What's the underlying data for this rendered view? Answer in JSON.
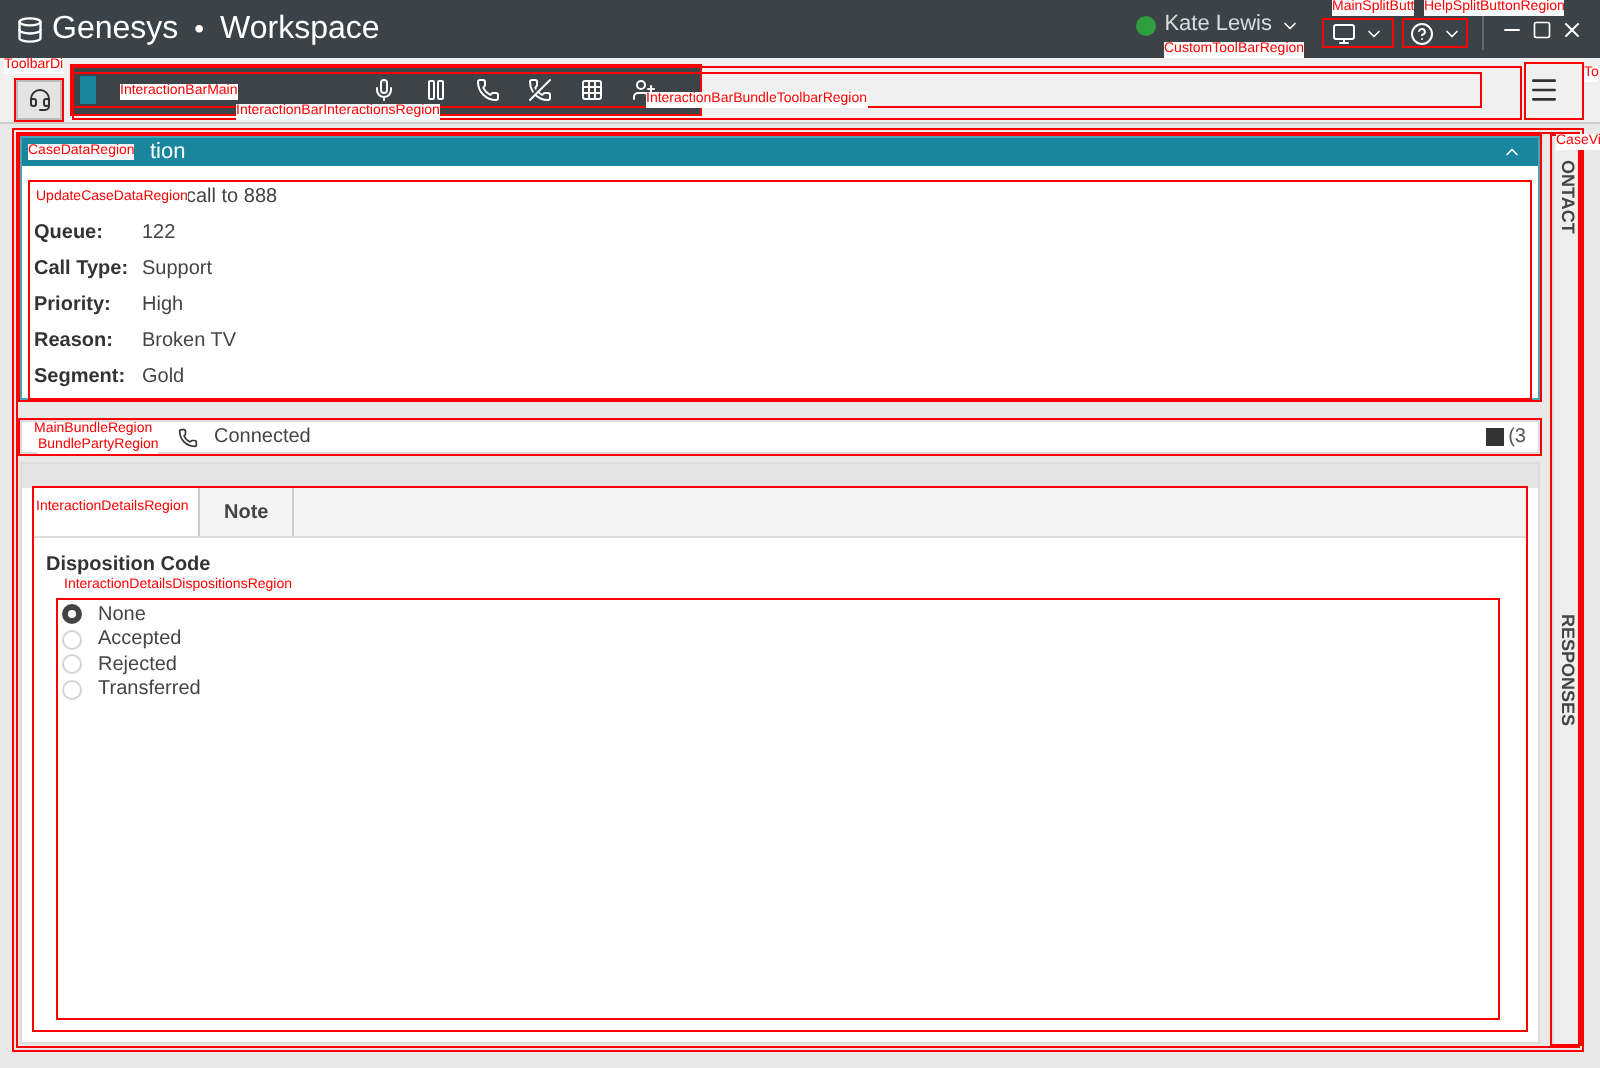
{
  "title_bar": {
    "brand": "Genesys",
    "separator": "•",
    "app": "Workspace",
    "user": {
      "name": "Kate Lewis"
    }
  },
  "case_data": {
    "header": "tion",
    "expanded": true,
    "subject": "call to 888",
    "fields": [
      {
        "label": "Queue:",
        "value": "122"
      },
      {
        "label": "Call Type:",
        "value": "Support"
      },
      {
        "label": "Priority:",
        "value": "High"
      },
      {
        "label": "Reason:",
        "value": "Broken TV"
      },
      {
        "label": "Segment:",
        "value": "Gold"
      }
    ]
  },
  "bundle": {
    "status": "Connected",
    "count": "(3"
  },
  "tabs": [
    {
      "label": "Note",
      "selected": false
    }
  ],
  "dispositions": {
    "title": "Disposition Code",
    "options": [
      {
        "label": "None",
        "selected": true
      },
      {
        "label": "Accepted",
        "selected": false
      },
      {
        "label": "Rejected",
        "selected": false
      },
      {
        "label": "Transferred",
        "selected": false
      }
    ]
  },
  "side_tabs": [
    "ONTACT",
    "RESPONSES"
  ],
  "region_labels": [
    "ToolbarDi",
    "InteractionBarMain",
    "InteractionBarInteractionsRegion",
    "InteractionBarBundleToolbarRegion",
    "CustomToolBarRegion",
    "MainSplitButt",
    "HelpSplitButtonRegion",
    "To",
    "CaseDataRegion",
    "UpdateCaseDataRegion",
    "CaseVi",
    "MainBundleRegion",
    "BundlePartyRegion",
    "InteractionDetailsRegion",
    "InteractionDetailsDispositionsRegion"
  ]
}
